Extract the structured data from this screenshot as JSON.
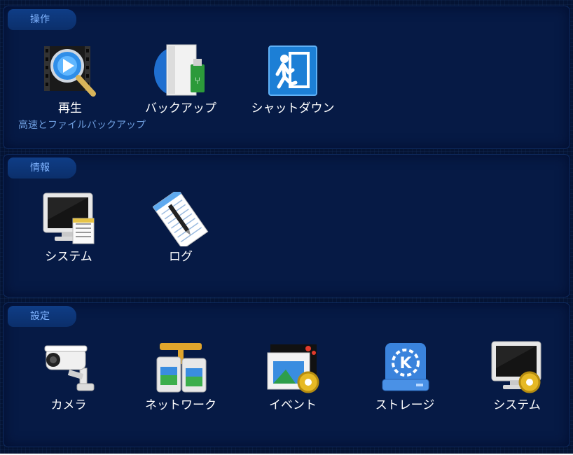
{
  "sections": {
    "operation": {
      "title": "操作",
      "items": [
        "再生",
        "バックアップ",
        "シャットダウン"
      ],
      "hint": "高速とファイルバックアップ"
    },
    "info": {
      "title": "情報",
      "items": [
        "システム",
        "ログ"
      ]
    },
    "settings": {
      "title": "設定",
      "items": [
        "カメラ",
        "ネットワーク",
        "イベント",
        "ストレージ",
        "システム"
      ]
    }
  },
  "icons": {
    "operation": [
      "playback-icon",
      "backup-icon",
      "shutdown-icon"
    ],
    "info": [
      "system-info-icon",
      "log-icon"
    ],
    "settings": [
      "camera-icon",
      "network-icon",
      "event-icon",
      "storage-icon",
      "system-settings-icon"
    ]
  },
  "colors": {
    "background": "#041333",
    "panel": "#061a45",
    "tab": "#0f3d86",
    "tab_text": "#7fb3ff",
    "hint_text": "#6f9fe0",
    "label_text": "#ffffff"
  }
}
